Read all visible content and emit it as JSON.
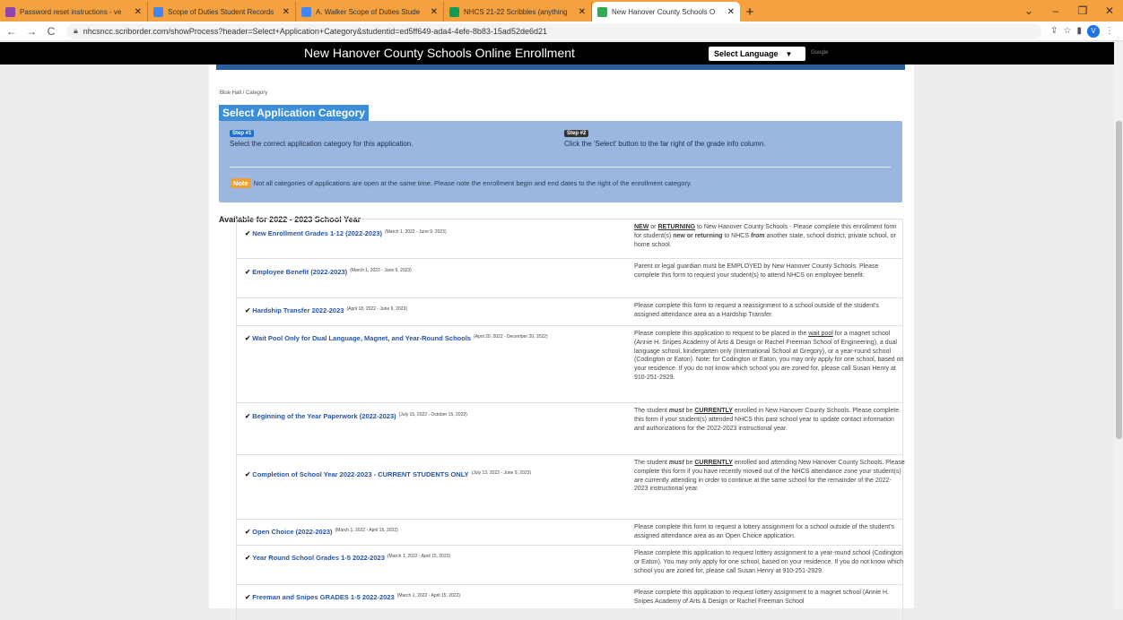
{
  "browser": {
    "tabs": [
      {
        "title": "Password reset instructions - ve",
        "icon_color": "#8e44ad"
      },
      {
        "title": "Scope of Duties Student Records",
        "icon_color": "#4285f4"
      },
      {
        "title": "A. Walker Scope of Duties Stude",
        "icon_color": "#4285f4"
      },
      {
        "title": "NHCS 21-22 Scribbles (anything",
        "icon_color": "#0f9d58"
      },
      {
        "title": "New Hanover County Schools O",
        "icon_color": "#34a853"
      }
    ],
    "url": "nhcsncc.scriborder.com/showProcess?header=Select+Application+Category&studentid=ed5ff649-ada4-4efe-8b83-15ad52de6d21",
    "avatar_letter": "V"
  },
  "site": {
    "title": "New Hanover County Schools Online Enrollment",
    "language_label": "Select Language",
    "google_label": "Google"
  },
  "page": {
    "breadcrumb": "Blue Hall / Category",
    "heading": "Select Application Category",
    "step1_badge": "Step #1",
    "step1_text": "Select the correct application category for this application.",
    "step2_badge": "Step #2",
    "step2_text": "Click the 'Select' button to the far right of the grade info column.",
    "note_badge": "Note",
    "note_text": "Not all categories of applications are open at the same time. Please note the enrollment begin and end dates to the right of the enrollment category.",
    "available_heading": "Available for 2022 - 2023 School Year",
    "categories": [
      {
        "name": "New Enrollment Grades 1-12 (2022-2023)",
        "dates": "(March 1, 2022 - June 9, 2023)",
        "desc_html": "<u><b>NEW</b></u> or <u><b>RETURNING</b></u> to New Hanover County Schools - Please complete this enrollment form for student(s) <b>new or returning</b> to NHCS <b><i>from</i></b> another state, school district, private school, or home school."
      },
      {
        "name": "Employee Benefit (2022-2023)",
        "dates": "(March 1, 2022 - June 9, 2023)",
        "desc_html": "Parent or legal guardian must be EMPLOYED by New Hanover County Schools.  Please complete this form to request your student(s) to attend NHCS on employee benefit."
      },
      {
        "name": "Hardship Transfer 2022-2023",
        "dates": "(April 18, 2022 - June 9, 2023)",
        "desc_html": "Please complete this form to request a reassignment to a school outside of the student's assigned attendance area as a Hardship Transfer."
      },
      {
        "name": "Wait Pool Only for Dual Language, Magnet, and Year-Round Schools",
        "dates": "(April 20, 2022 - December 20, 2022)",
        "desc_html": "Please complete this application to request to be placed in the <u>wait pool</u> for a magnet school (Annie H. Snipes Academy of Arts &amp; Design or Rachel Freeman School of Engineering), a dual language school, kindergarten only (International School at Gregory), or a year-round school (Codington or Eaton).  Note: for Codington or Eaton, you may only apply for one school, based on your residence.  If you do not know which school you are zoned for, please call Susan Henry at 910-251-2929."
      },
      {
        "name": "Beginning of the Year Paperwork (2022-2023)",
        "dates": "(July 15, 2022 - October 15, 2022)",
        "desc_html": "The student <b><i>must</i></b> be <u><b>CURRENTLY</b></u> enrolled in New Hanover County Schools. Please complete this form if your student(s) attended NHCS this past school year to update contact information and authorizations for the 2022-2023 instructional year."
      },
      {
        "name": "Completion of School Year 2022-2023 - CURRENT STUDENTS ONLY",
        "dates": "(July 13, 2022 - June 9, 2023)",
        "desc_html": "The student <b><i>must</i></b> be <u><b>CURRENTLY</b></u> enrolled and attending New Hanover County Schools.  Please complete this form if you have recently moved out of the NHCS attendance zone your student(s) are currently attending in order to continue at the same school for the remainder of the 2022-2023 instructional year."
      },
      {
        "name": "Open Choice (2022-2023)",
        "dates": "(March 1, 2022 - April 15, 2022)",
        "desc_html": "Please complete this form to request a lottery assignment for a school outside of the student's assigned attendance area as an Open Choice application."
      },
      {
        "name": "Year Round School Grades 1-5 2022-2023",
        "dates": "(March 1, 2022 - April 15, 2022)",
        "desc_html": "Please complete this application to request lottery assignment to a year-round school (Codington or Eaton).  You may only apply for one school, based on your residence.  If you do not know which school you are zoned for, please call Susan Henry at 910-251-2929."
      },
      {
        "name": "Freeman and Snipes GRADES 1-5 2022-2023",
        "dates": "(March 1, 2022 - April 15, 2022)",
        "desc_html": "Please complete this application to request lottery assignment to a magnet school (Annie H. Snipes Academy of Arts &amp; Design or Rachel Freeman School"
      }
    ]
  }
}
